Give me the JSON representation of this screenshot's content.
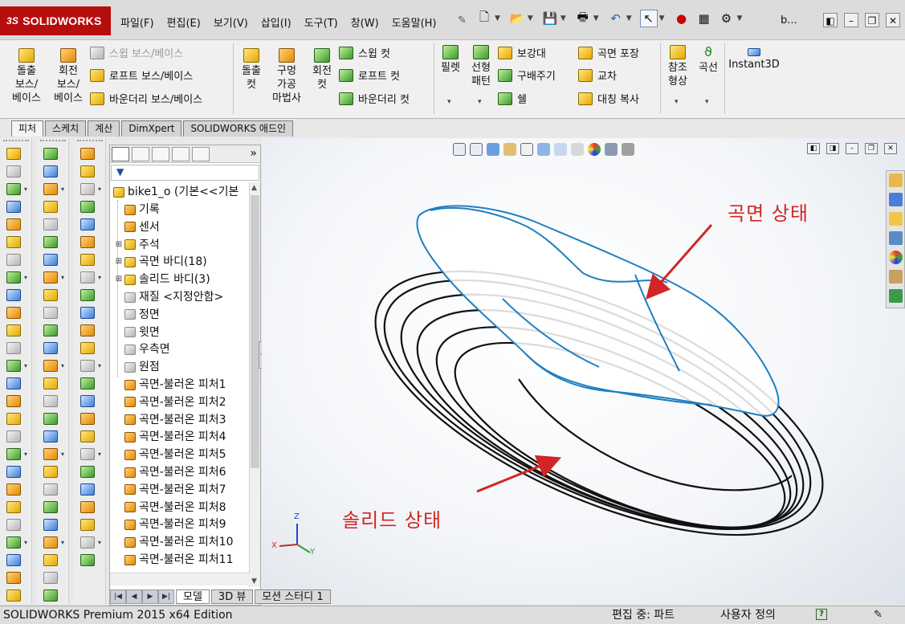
{
  "app": {
    "logo_prefix": "3S",
    "logo": "SOLIDWORKS",
    "document_title": "b..."
  },
  "menu": [
    "파일(F)",
    "편집(E)",
    "보기(V)",
    "삽입(I)",
    "도구(T)",
    "창(W)",
    "도움말(H)"
  ],
  "ribbon": {
    "extrude_boss": "돌출\n보스/\n베이스",
    "revolve_boss": "회전\n보스/\n베이스",
    "sweep_boss": "스윕 보스/베이스",
    "loft_boss": "로프트 보스/베이스",
    "boundary_boss": "바운더리 보스/베이스",
    "extrude_cut": "돌출\n컷",
    "hole_wizard": "구멍\n가공\n마법사",
    "revolve_cut": "회전\n컷",
    "sweep_cut": "스윕 컷",
    "loft_cut": "로프트 컷",
    "boundary_cut": "바운더리 컷",
    "fillet": "필렛",
    "linear_pattern": "선형\n패턴",
    "rib": "보강대",
    "draft": "구배주기",
    "shell": "쉘",
    "wrap": "곡면 포장",
    "intersect": "교차",
    "mirror": "대칭 복사",
    "ref_geometry": "참조\n형상",
    "curves": "곡선",
    "instant3d": "Instant3D"
  },
  "tabs": [
    "피처",
    "스케치",
    "계산",
    "DimXpert",
    "SOLIDWORKS 애드인"
  ],
  "feature_tree": {
    "root": "bike1_o  (기본<<기본",
    "items": [
      {
        "label": "기록",
        "expandable": false
      },
      {
        "label": "센서",
        "expandable": false
      },
      {
        "label": "주석",
        "expandable": true
      },
      {
        "label": "곡면 바디(18)",
        "expandable": true
      },
      {
        "label": "솔리드 바디(3)",
        "expandable": true
      },
      {
        "label": "재질 <지정안함>",
        "expandable": false
      },
      {
        "label": "정면",
        "expandable": false
      },
      {
        "label": "윗면",
        "expandable": false
      },
      {
        "label": "우측면",
        "expandable": false
      },
      {
        "label": "원점",
        "expandable": false
      },
      {
        "label": "곡면-불러온 피처1",
        "expandable": false
      },
      {
        "label": "곡면-불러온 피처2",
        "expandable": false
      },
      {
        "label": "곡면-불러온 피처3",
        "expandable": false
      },
      {
        "label": "곡면-불러온 피처4",
        "expandable": false
      },
      {
        "label": "곡면-불러온 피처5",
        "expandable": false
      },
      {
        "label": "곡면-불러온 피처6",
        "expandable": false
      },
      {
        "label": "곡면-불러온 피처7",
        "expandable": false
      },
      {
        "label": "곡면-불러온 피처8",
        "expandable": false
      },
      {
        "label": "곡면-불러온 피처9",
        "expandable": false
      },
      {
        "label": "곡면-불러온 피처10",
        "expandable": false
      },
      {
        "label": "곡면-불러온 피처11",
        "expandable": false
      }
    ],
    "more_label": "»"
  },
  "annotations": {
    "surface_state": "곡면 상태",
    "solid_state": "솔리드 상태"
  },
  "triad": {
    "x": "X",
    "y": "Y",
    "z": "Z"
  },
  "bottom_tabs": [
    "모델",
    "3D 뷰",
    "모션 스터디 1"
  ],
  "status": {
    "product": "SOLIDWORKS Premium 2015 x64 Edition",
    "editing": "편집 중: 파트",
    "units": "사용자 정의",
    "help": "?"
  },
  "colors": {
    "brand": "#b80d0d",
    "surface_edges": "#1f7fc0",
    "solid_edges": "#111111",
    "annotation": "#d32525"
  }
}
